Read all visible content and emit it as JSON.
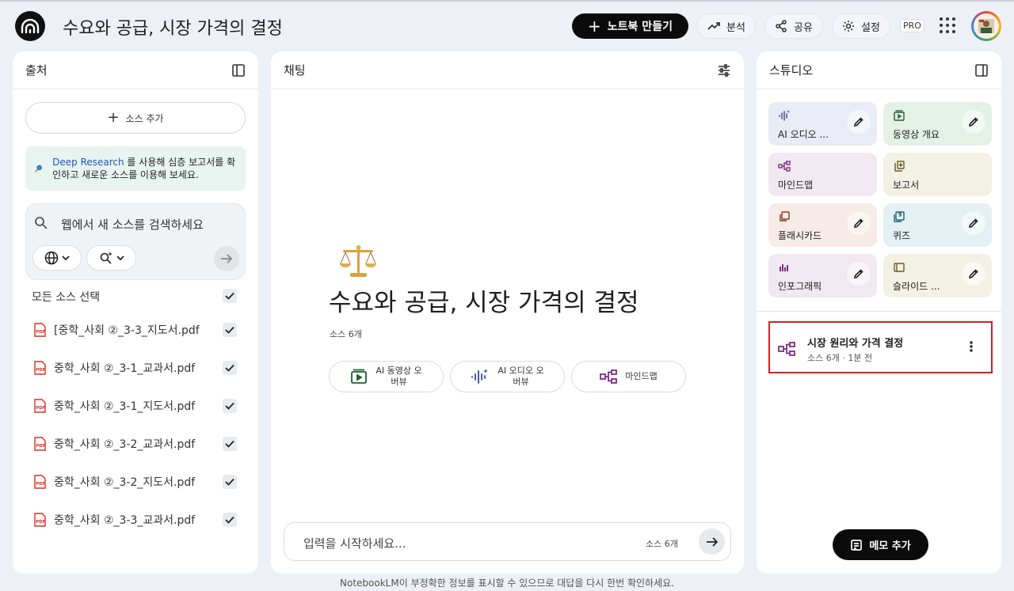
{
  "header": {
    "title": "수요와 공급, 시장 가격의 결정",
    "create_notebook": "노트북 만들기",
    "analytics": "분석",
    "share": "공유",
    "settings": "설정",
    "pro_badge": "PRO"
  },
  "sources": {
    "title": "출처",
    "add_source": "소스 추가",
    "deep_research_link": "Deep Research",
    "deep_research_text": " 를 사용해 심층 보고서를 확인하고 새로운 소스를 이용해 보세요.",
    "search_placeholder": "웹에서 새 소스를 검색하세요",
    "select_all": "모든 소스 선택",
    "files": [
      {
        "name": "[중학_사회 ②_3-3_지도서.pdf",
        "checked": true
      },
      {
        "name": "중학_사회 ②_3-1_교과서.pdf",
        "checked": true
      },
      {
        "name": "중학_사회 ②_3-1_지도서.pdf",
        "checked": true
      },
      {
        "name": "중학_사회 ②_3-2_교과서.pdf",
        "checked": true
      },
      {
        "name": "중학_사회 ②_3-2_지도서.pdf",
        "checked": true
      },
      {
        "name": "중학_사회 ②_3-3_교과서.pdf",
        "checked": true
      }
    ]
  },
  "chat": {
    "title": "채팅",
    "emoji": "⚖️",
    "notebook_title": "수요와 공급, 시장 가격의 결정",
    "source_count": "소스 6개",
    "chips": [
      {
        "label": "AI 동영상 오버뷰",
        "icon": "video-overview-icon"
      },
      {
        "label": "AI 오디오 오버뷰",
        "icon": "audio-overview-icon"
      },
      {
        "label": "마인드맵",
        "icon": "mindmap-icon"
      }
    ],
    "chip_video_line1": "AI 동영상 오",
    "chip_video_line2": "버뷰",
    "chip_audio_line1": "AI 오디오 오",
    "chip_audio_line2": "버뷰",
    "input_placeholder": "입력을 시작하세요...",
    "input_source_count": "소스 6개"
  },
  "studio": {
    "title": "스튜디오",
    "tiles": [
      {
        "label": "AI 오디오 ...",
        "color": "#e9ebf6",
        "icon_color": "#3b4a8a"
      },
      {
        "label": "동영상 개요",
        "color": "#e3f1e6",
        "icon_color": "#1e5e34"
      },
      {
        "label": "마인드맵",
        "color": "#f1e9f2",
        "icon_color": "#7a2d7f"
      },
      {
        "label": "보고서",
        "color": "#f3f1e4",
        "icon_color": "#6b5a1e"
      },
      {
        "label": "플래시카드",
        "color": "#f7ebe7",
        "icon_color": "#8a3a22"
      },
      {
        "label": "퀴즈",
        "color": "#e3f1f5",
        "icon_color": "#1f5f7a"
      },
      {
        "label": "인포그래픽",
        "color": "#f1e9f2",
        "icon_color": "#7a2d7f"
      },
      {
        "label": "슬라이드 ...",
        "color": "#f3f1e4",
        "icon_color": "#6b5a1e"
      }
    ],
    "note_title": "시장 원리와 가격 결정",
    "note_sub": "소스 6개 · 1분 전",
    "add_memo": "메모 추가"
  },
  "footer": "NotebookLM이 부정확한 정보를 표시할 수 있으므로 대답을 다시 한번 확인하세요."
}
